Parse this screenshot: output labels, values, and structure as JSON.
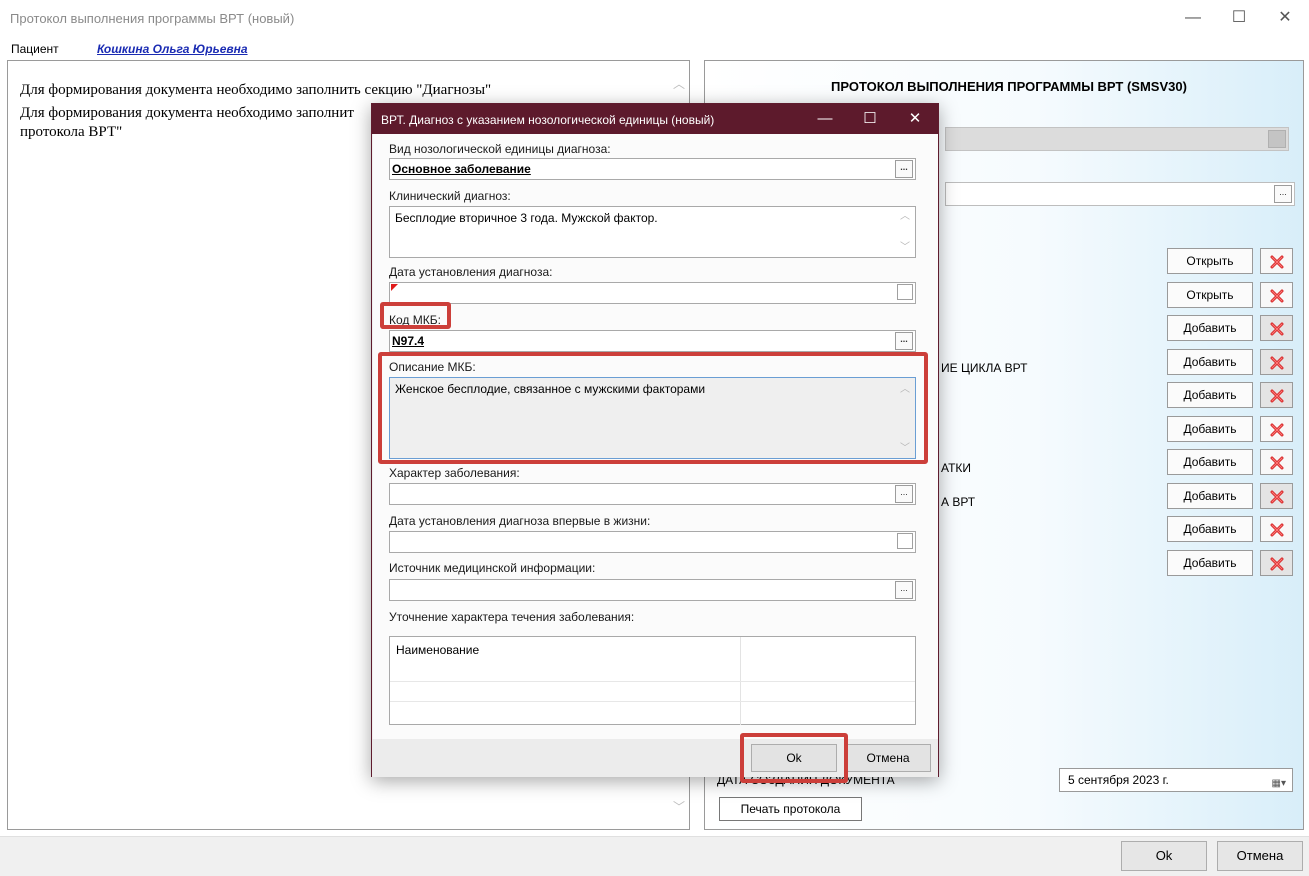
{
  "window": {
    "title": "Протокол выполнения программы ВРТ (новый)",
    "controls": {
      "minimize": "—",
      "maximize": "☐",
      "close": "✕"
    }
  },
  "patient": {
    "label": "Пациент",
    "name": "Кошкина Ольга Юрьевна"
  },
  "left_panel": {
    "messages": [
      "Для формирования документа необходимо заполнить секцию \"Диагнозы\"",
      "Для формирования документа необходимо заполнит",
      "протокола ВРТ\""
    ]
  },
  "right_panel": {
    "title": "ПРОТОКОЛ ВЫПОЛНЕНИЯ ПРОГРАММЫ ВРТ (SMSV30)",
    "rows": [
      {
        "label": "",
        "button": "Открыть",
        "delete_enabled": true
      },
      {
        "label": "",
        "button": "Открыть",
        "delete_enabled": true
      },
      {
        "label": "",
        "button": "Добавить",
        "delete_enabled": false
      },
      {
        "label": "ИЕ ЦИКЛА ВРТ",
        "button": "Добавить",
        "delete_enabled": false
      },
      {
        "label": "",
        "button": "Добавить",
        "delete_enabled": false
      },
      {
        "label": "",
        "button": "Добавить",
        "delete_enabled": true
      },
      {
        "label": "АТКИ",
        "button": "Добавить",
        "delete_enabled": true
      },
      {
        "label": "А ВРТ",
        "button": "Добавить",
        "delete_enabled": false
      },
      {
        "label": "",
        "button": "Добавить",
        "delete_enabled": true
      },
      {
        "label": "",
        "button": "Добавить",
        "delete_enabled": false
      }
    ],
    "date_label": "ДАТА СОЗДАНИЯ ДОКУМЕНТА",
    "date_value": "5 сентября 2023 г.",
    "print_button": "Печать протокола"
  },
  "bottom": {
    "ok": "Ok",
    "cancel": "Отмена"
  },
  "modal": {
    "title": "ВРТ. Диагноз с указанием нозологической единицы (новый)",
    "controls": {
      "minimize": "—",
      "maximize": "☐",
      "close": "✕"
    },
    "fields": {
      "nosology_label": "Вид нозологической единицы диагноза:",
      "nosology_value": "Основное заболевание",
      "clinical_label": "Клинический диагноз:",
      "clinical_value": "Бесплодие вторичное 3 года. Мужской фактор.",
      "date_label": "Дата установления диагноза:",
      "mkb_code_label": "Код МКБ:",
      "mkb_code_value": "N97.4",
      "mkb_desc_label": "Описание МКБ:",
      "mkb_desc_value": "Женское бесплодие, связанное с мужскими факторами",
      "character_label": "Характер заболевания:",
      "first_date_label": "Дата установления диагноза впервые в жизни:",
      "source_label": "Источник медицинской информации:",
      "refine_label": "Уточнение характера течения заболевания:",
      "grid_header": "Наименование"
    },
    "ok": "Ok",
    "cancel": "Отмена",
    "ellipsis": "..."
  },
  "colors": {
    "modal_titlebar": "#5d1a2c",
    "highlight": "#cc3f3a",
    "patient_link": "#1a2bb3"
  },
  "icons": {
    "delete": "red-x-icon",
    "calendar": "calendar-icon"
  }
}
